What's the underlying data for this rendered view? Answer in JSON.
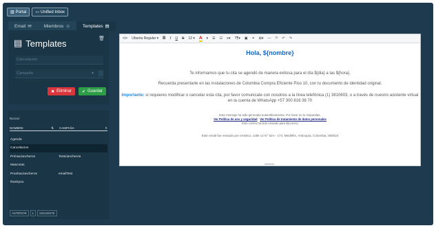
{
  "topbar": {
    "portal_label": "Portal",
    "unified_inbox_label": "Unified Inbox"
  },
  "tabs": [
    {
      "label": "Email",
      "icon": "envelope-icon"
    },
    {
      "label": "Miembros",
      "icon": "users-icon"
    },
    {
      "label": "Templates",
      "icon": "template-icon"
    }
  ],
  "template_panel": {
    "title": "Templates",
    "name_placeholder": "Cancelacion",
    "campaign_placeholder": "Campaña",
    "delete_label": "Eliminar",
    "save_label": "Guardar"
  },
  "list": {
    "search_label": "Buscar:",
    "col_name": "NOMBRE",
    "col_campaign": "CAMPAÑA",
    "rows": [
      {
        "name": "Agenda",
        "campaign": ""
      },
      {
        "name": "Cancelacion",
        "campaign": ""
      },
      {
        "name": "PrimaLlancheros",
        "campaign": "TestLlancheros"
      },
      {
        "name": "Mascotas",
        "campaign": ""
      },
      {
        "name": "PruebaLlancheros",
        "campaign": "emailTest"
      },
      {
        "name": "thankyou",
        "campaign": ""
      }
    ],
    "selected_index": 1,
    "prev_label": "ANTERIOR",
    "page": "1",
    "next_label": "SIGUIENTE"
  },
  "editor": {
    "toolbar": {
      "font_name": "Ubuntu Regular",
      "font_size": "12"
    },
    "heading": "Hola, ${nombre}",
    "p1": "Te informamos que tu cita se agendó de manera exitosa para el día ${dia} a las ${hora}.",
    "p2": "Recuerda presentarte en las instalaciones de Colombia Compra Eficiente Piso 10, con tu documento de identidad original.",
    "p3_label": "Importante:",
    "p3_text": " si requieres modificar o cancelar esta cita, por favor comunicate con nosotros a la línea telefónica (1) 3810603, o a través de nuestro asistente virtual en la cuenta de WhatsApp  +57 300 816 38 70",
    "auto_msg": "Este mensaje ha sido generado automáticamente. Por favor no lo respondas.",
    "link1": "Ver Política de uso y seguridad",
    "link2": "Ver Política de tratamiento de datos personales",
    "sent_to": "Este correo ha sido enviado para ${correo}",
    "footer": "Este email fue enviado por emtelco, calle 14 N° 52A - 174, Medellín, Antioquia, Colombia, 050024"
  },
  "colors": {
    "frame": "#1d3a4e",
    "panel": "#1a3546",
    "delete": "#d9363e",
    "save": "#2e9d47",
    "heading": "#1565c0"
  }
}
